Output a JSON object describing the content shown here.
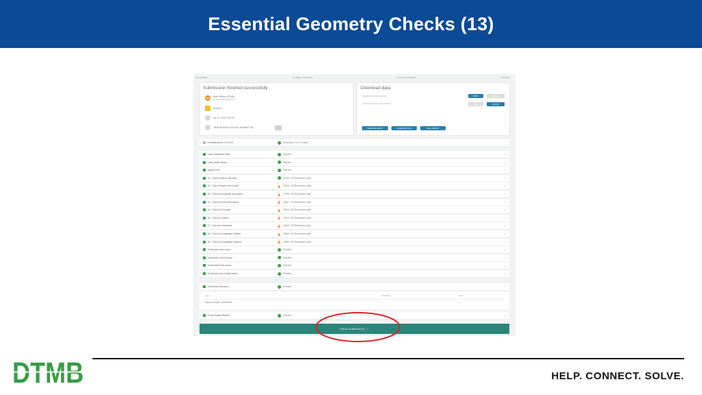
{
  "slide": {
    "title": "Essential Geometry Checks (13)",
    "tagline": "HELP. CONNECT. SOLVE.",
    "logo_text": "DTMB",
    "accent_color": "#0b4a96",
    "logo_green": "#3a9b46",
    "logo_blue": "#1e6fb4",
    "highlight_color": "#d8232a"
  },
  "screenshot": {
    "steps": [
      "Upload Data",
      "Configure Processing",
      "Process Submission",
      "Summary"
    ],
    "submission": {
      "title": "Submission finished successfully",
      "user_initials": "MW",
      "user_name": "Mark Withers (DTMB)",
      "user_email": "markwithers@michigan.gov",
      "status": "Success",
      "date": "Apr 27, 2023 2:34 PM",
      "submission_id": "2f4ab33b-8a3d-47cb-b3d7-f49ba4677d4c",
      "processing_time": "Processing time: 00:00:33",
      "processed_count": "Processed 70 of 70 steps"
    },
    "download": {
      "title": "Download data",
      "line1": "Download as a processed data",
      "line2": "Essential Geometry Checks Report",
      "btn_input": "INPUT",
      "btn_output": "OUTPUT",
      "btn_map": "VIEW",
      "btn_report_disabled": "REPORT",
      "btn_templates": "TEMPLATE READY",
      "btn_download_log": "DOWNLOAD LOG",
      "btn_save_report": "SAVE REPORT"
    },
    "rows": [
      {
        "name": "Load Submission Data",
        "status": "ok",
        "text": "Finished"
      },
      {
        "name": "Load Quality Report",
        "status": "ok",
        "text": "Finished"
      },
      {
        "name": "Apply to Set",
        "status": "ok",
        "text": "Finished"
      },
      {
        "name": "01 - Check Features are Valid",
        "status": "ok",
        "text": "23795 / 23795 features valid"
      },
      {
        "name": "02 - Check Features are Closed",
        "status": "warn",
        "text": "23792 / 23795 features valid"
      },
      {
        "name": "03 - Check for Duplicate Geometries",
        "status": "warn",
        "text": "23790 / 23795 features valid"
      },
      {
        "name": "04 - Check for Self Intersections",
        "status": "warn",
        "text": "23537 / 23795 features valid"
      },
      {
        "name": "05 - Check for Overlaps",
        "status": "warn",
        "text": "23430 / 23795 features valid"
      },
      {
        "name": "06 - Check for Spikes",
        "status": "warn",
        "text": "23570 / 23795 features valid"
      },
      {
        "name": "07 - Check for Sliverness",
        "status": "warn",
        "text": "23559 / 23795 features valid"
      },
      {
        "name": "08 - Check for Duplicated Vertices",
        "status": "warn",
        "text": "23699 / 23795 features valid"
      },
      {
        "name": "09 - Check for Duplicated Features",
        "status": "warn",
        "text": "23699 / 23795 features valid"
      },
      {
        "name": "Summarize Area Issues",
        "status": "ok",
        "text": "Finished"
      },
      {
        "name": "Summarize Linear Issues",
        "status": "ok",
        "text": "Finished"
      },
      {
        "name": "Summarize Point Issues",
        "status": "ok",
        "text": "Finished"
      },
      {
        "name": "Summarize Non-Spatial Issues",
        "status": "ok",
        "text": "Finished"
      },
      {
        "name": "Summarize All Issues",
        "status": "ok",
        "text": "Finished"
      }
    ],
    "issues_table": {
      "col1": "Layer",
      "col2": "Processed",
      "col3": "Errors",
      "row_name": "Report ISSUES_SUMMARY",
      "row_processed": "1",
      "row_errors": "0"
    },
    "last_row": {
      "name": "Export Spatial Results",
      "status": "ok",
      "text": "Finished"
    },
    "finish_button": "FINISH SUBMISSION"
  }
}
